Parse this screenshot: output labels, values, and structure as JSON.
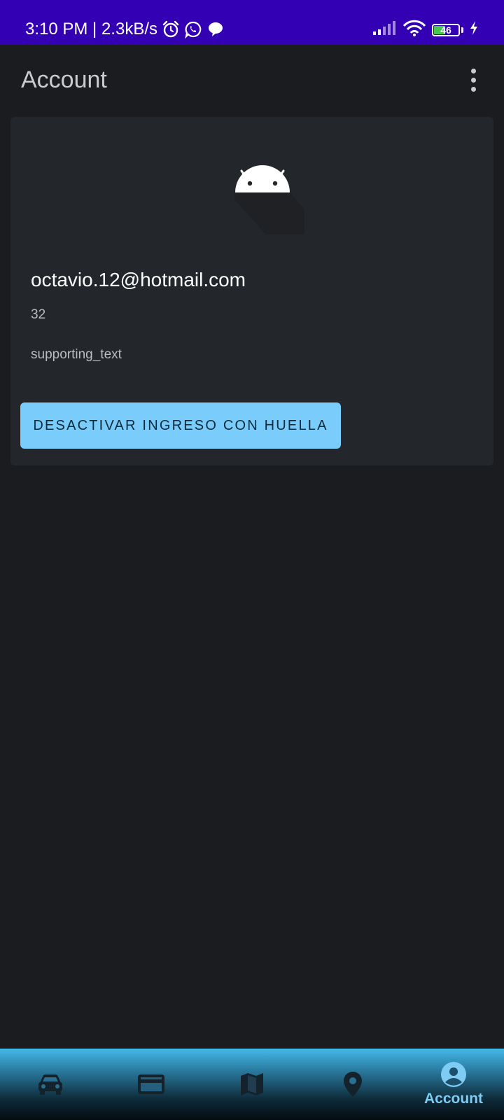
{
  "status_bar": {
    "time_speed": "3:10 PM | 2.3kB/s",
    "network_type": "4G",
    "signal_small_label": "6",
    "battery_level": "46",
    "battery_fraction": 0.46
  },
  "app_bar": {
    "title": "Account"
  },
  "card": {
    "email": "octavio.12@hotmail.com",
    "number": "32",
    "supporting_text": "supporting_text",
    "button_label": "DESACTIVAR INGRESO CON HUELLA"
  },
  "bottom_nav": {
    "items": [
      {
        "icon": "car-icon",
        "label": ""
      },
      {
        "icon": "credit-card-icon",
        "label": ""
      },
      {
        "icon": "map-icon",
        "label": ""
      },
      {
        "icon": "location-pin-icon",
        "label": ""
      },
      {
        "icon": "account-circle-icon",
        "label": "Account",
        "selected": true
      }
    ]
  },
  "colors": {
    "status_bar": "#3300b3",
    "background": "#1a1c1f",
    "card": "#23262a",
    "accent": "#7acdfb",
    "nav_icon": "#14222c",
    "nav_selected": "#7ecbf3"
  }
}
